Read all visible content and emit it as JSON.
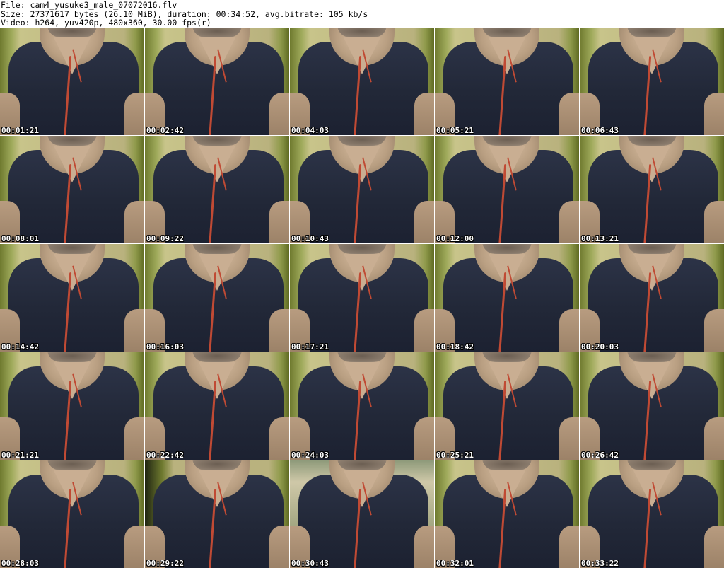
{
  "header": {
    "line1": "File: cam4_yusuke3_male_07072016.flv",
    "line2": "Size: 27371617 bytes (26.10 MiB), duration: 00:34:52, avg.bitrate: 105 kb/s",
    "line3": "Video: h264, yuv420p, 480x360, 30.00 fps(r)"
  },
  "thumbnails": [
    {
      "timestamp": "00:01:21"
    },
    {
      "timestamp": "00:02:42"
    },
    {
      "timestamp": "00:04:03"
    },
    {
      "timestamp": "00:05:21"
    },
    {
      "timestamp": "00:06:43"
    },
    {
      "timestamp": "00:08:01"
    },
    {
      "timestamp": "00:09:22"
    },
    {
      "timestamp": "00:10:43"
    },
    {
      "timestamp": "00:12:00"
    },
    {
      "timestamp": "00:13:21"
    },
    {
      "timestamp": "00:14:42"
    },
    {
      "timestamp": "00:16:03"
    },
    {
      "timestamp": "00:17:21"
    },
    {
      "timestamp": "00:18:42"
    },
    {
      "timestamp": "00:20:03"
    },
    {
      "timestamp": "00:21:21"
    },
    {
      "timestamp": "00:22:42"
    },
    {
      "timestamp": "00:24:03"
    },
    {
      "timestamp": "00:25:21"
    },
    {
      "timestamp": "00:26:42"
    },
    {
      "timestamp": "00:28:03"
    },
    {
      "timestamp": "00:29:22"
    },
    {
      "timestamp": "00:30:43"
    },
    {
      "timestamp": "00:32:01"
    },
    {
      "timestamp": "00:33:22"
    }
  ]
}
